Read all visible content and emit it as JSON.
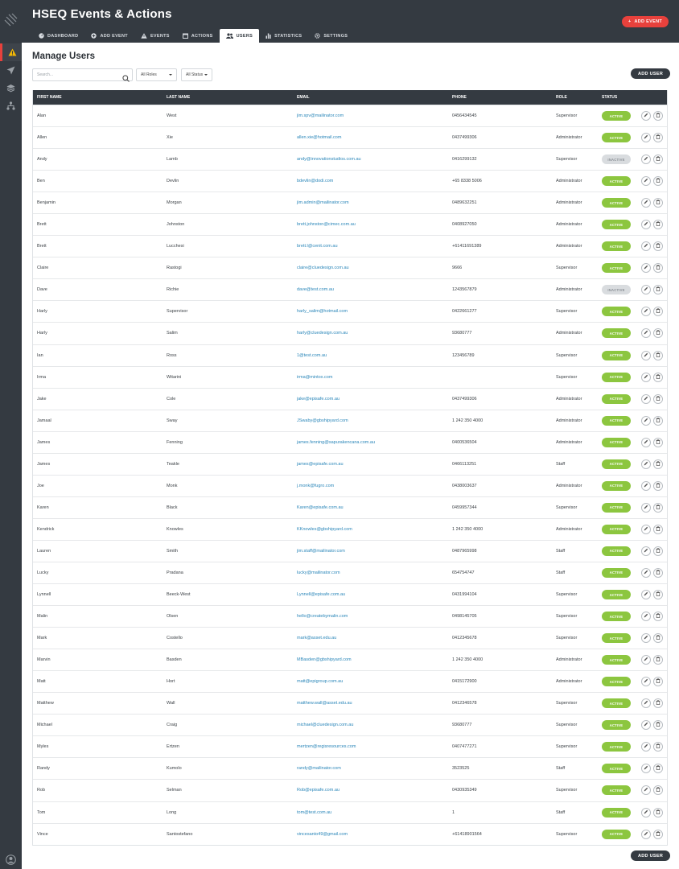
{
  "app": {
    "title": "HSEQ Events & Actions",
    "add_event": "ADD EVENT",
    "accent": "#e8413c"
  },
  "tabs": [
    {
      "label": "DASHBOARD",
      "icon": "dashboard-icon"
    },
    {
      "label": "ADD EVENT",
      "icon": "plus-circle-icon"
    },
    {
      "label": "EVENTS",
      "icon": "warning-icon"
    },
    {
      "label": "ACTIONS",
      "icon": "calendar-icon"
    },
    {
      "label": "USERS",
      "icon": "users-icon",
      "active": true
    },
    {
      "label": "STATISTICS",
      "icon": "bar-chart-icon"
    },
    {
      "label": "SETTINGS",
      "icon": "gear-icon"
    }
  ],
  "rail": [
    "warning-icon",
    "send-icon",
    "layers-icon",
    "hierarchy-icon"
  ],
  "page": {
    "title": "Manage Users",
    "search_placeholder": "Search...",
    "roles_filter": "All Roles",
    "status_filter": "All Status",
    "add_user": "ADD USER"
  },
  "table": {
    "columns": [
      "FIRST NAME",
      "LAST NAME",
      "EMAIL",
      "PHONE",
      "ROLE",
      "STATUS"
    ],
    "rows": [
      [
        "Alan",
        "West",
        "jim.spv@mailinator.com",
        "0456434545",
        "Supervisor",
        "ACTIVE"
      ],
      [
        "Allen",
        "Xie",
        "allen.xie@hotmail.com",
        "0437499306",
        "Administrator",
        "ACTIVE"
      ],
      [
        "Andy",
        "Lamb",
        "andy@innovationstudios.com.au",
        "0416299132",
        "Supervisor",
        "INACTIVE"
      ],
      [
        "Ben",
        "Devlin",
        "bdevlin@dodi.com",
        "+65 8338 5006",
        "Administrator",
        "ACTIVE"
      ],
      [
        "Benjamin",
        "Morgan",
        "jim.admin@mailinator.com",
        "0489632251",
        "Administrator",
        "ACTIVE"
      ],
      [
        "Brett",
        "Johnston",
        "brett.johnston@cimec.com.au",
        "0408927050",
        "Administrator",
        "ACTIVE"
      ],
      [
        "Brett",
        "Lucchesi",
        "brett.l@cenit.com.au",
        "+61411691389",
        "Administrator",
        "ACTIVE"
      ],
      [
        "Claire",
        "Rastogi",
        "claire@cluedesign.com.au",
        "9666",
        "Supervisor",
        "ACTIVE"
      ],
      [
        "Dave",
        "Richie",
        "dave@test.com.au",
        "1243567879",
        "Administrator",
        "INACTIVE"
      ],
      [
        "Harly",
        "Supervisor",
        "harly_salim@hotmail.com",
        "0422661277",
        "Supervisor",
        "ACTIVE"
      ],
      [
        "Harly",
        "Salim",
        "harly@cluedesign.com.au",
        "93680777",
        "Administrator",
        "ACTIVE"
      ],
      [
        "Ian",
        "Ross",
        "1@test.com.au",
        "123456789",
        "Supervisor",
        "ACTIVE"
      ],
      [
        "Irma",
        "Witarini",
        "irma@mintox.com",
        "",
        "Supervisor",
        "ACTIVE"
      ],
      [
        "Jake",
        "Cole",
        "jake@episafe.com.au",
        "0437499306",
        "Administrator",
        "ACTIVE"
      ],
      [
        "Jamaal",
        "Sway",
        "JSwaby@gbshipyard.com",
        "1 242 350 4000",
        "Administrator",
        "ACTIVE"
      ],
      [
        "James",
        "Fenning",
        "james.fenning@sapurakencana.com.au",
        "0400536504",
        "Administrator",
        "ACTIVE"
      ],
      [
        "James",
        "Teakle",
        "james@episafe.com.au",
        "0466113251",
        "Staff",
        "ACTIVE"
      ],
      [
        "Joe",
        "Monk",
        "j.monk@fugro.com",
        "0438003637",
        "Administrator",
        "ACTIVE"
      ],
      [
        "Karen",
        "Black",
        "Karen@episafe.com.au",
        "0459957344",
        "Supervisor",
        "ACTIVE"
      ],
      [
        "Kendrick",
        "Knowles",
        "KKnowles@gbshipyard.com",
        "1 242 350 4000",
        "Administrator",
        "ACTIVE"
      ],
      [
        "Lauren",
        "Smith",
        "jim.staff@mailinator.com",
        "0487965998",
        "Staff",
        "ACTIVE"
      ],
      [
        "Lucky",
        "Pradana",
        "lucky@mailinator.com",
        "654754747",
        "Staff",
        "ACTIVE"
      ],
      [
        "Lynnell",
        "Beeck-West",
        "Lynnell@episafe.com.au",
        "0431994104",
        "Supervisor",
        "ACTIVE"
      ],
      [
        "Malin",
        "Olsen",
        "hello@createbymalin.com",
        "0498145705",
        "Supervisor",
        "ACTIVE"
      ],
      [
        "Mark",
        "Costello",
        "mark@asset.edu.au",
        "0412345678",
        "Supervisor",
        "ACTIVE"
      ],
      [
        "Marvin",
        "Basden",
        "MBasden@gbshipyard.com",
        "1 242 350 4000",
        "Administrator",
        "ACTIVE"
      ],
      [
        "Matt",
        "Hort",
        "matt@epigroup.com.au",
        "0415172900",
        "Administrator",
        "ACTIVE"
      ],
      [
        "Matthew",
        "Wall",
        "matthew.wall@asset.edu.au",
        "0412346578",
        "Supervisor",
        "ACTIVE"
      ],
      [
        "Michael",
        "Craig",
        "michael@cluedesign.com.au",
        "93680777",
        "Supervisor",
        "ACTIVE"
      ],
      [
        "Myles",
        "Ertzen",
        "mertzen@regisresources.com",
        "0407477271",
        "Supervisor",
        "ACTIVE"
      ],
      [
        "Randy",
        "Kumolo",
        "randy@mailinator.com",
        "3523525",
        "Staff",
        "ACTIVE"
      ],
      [
        "Rob",
        "Selman",
        "Rob@episafe.com.au",
        "0430935349",
        "Supervisor",
        "ACTIVE"
      ],
      [
        "Tom",
        "Long",
        "tom@test.com.au",
        "1",
        "Staff",
        "ACTIVE"
      ],
      [
        "Vince",
        "Santostefano",
        "vincesanto49@gmail.com",
        "+61418901564",
        "Supervisor",
        "ACTIVE"
      ]
    ]
  }
}
